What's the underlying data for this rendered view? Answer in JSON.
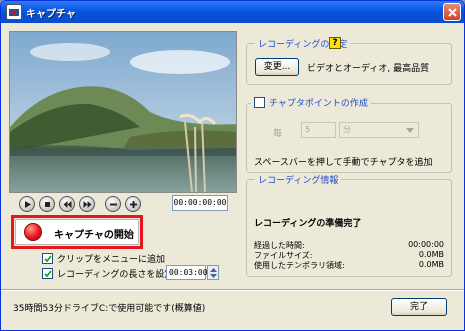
{
  "window": {
    "title": "キャプチャ"
  },
  "transport": {
    "time": "00:00:00:00"
  },
  "capture": {
    "start_label": "キャプチャの開始"
  },
  "options": {
    "add_to_menu": {
      "label": "クリップをメニューに追加",
      "checked": true
    },
    "set_length": {
      "label": "レコーディングの長さを設定",
      "checked": true,
      "value": "00:03:00"
    }
  },
  "recording_settings": {
    "legend": "レコーディングの設定",
    "change_button": "変更...",
    "summary": "ビデオとオーディオ, 最高品質"
  },
  "chapter_points": {
    "legend": "チャプタポイントの作成",
    "checked": false,
    "every_label": "毎",
    "interval_value": "5",
    "unit_value": "分",
    "hint": "スペースバーを押して手動でチャプタを追加"
  },
  "recording_info": {
    "legend": "レコーディング情報",
    "status": "レコーディングの準備完了",
    "rows": [
      {
        "label": "経過した時間:",
        "value": "00:00:00"
      },
      {
        "label": "ファイルサイズ:",
        "value": "0.0MB"
      },
      {
        "label": "使用したテンポラリ領域:",
        "value": "0.0MB"
      }
    ]
  },
  "footer": {
    "status": "35時間53分ドライブC:で使用可能です(概算値)",
    "done_button": "完了"
  }
}
